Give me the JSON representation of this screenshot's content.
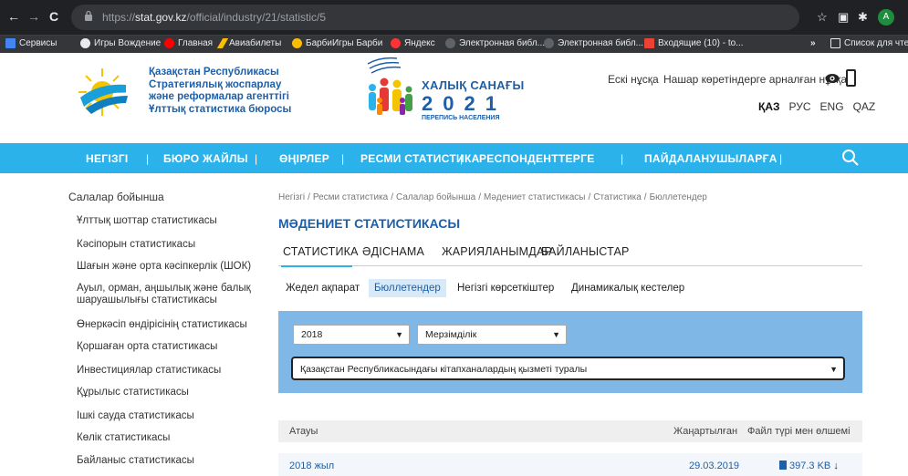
{
  "browser": {
    "back": "←",
    "forward": "→",
    "reload": "C",
    "url_prefix": "https://",
    "url_domain": "stat.gov.kz",
    "url_path": "/official/industry/21/statistic/5",
    "avatar": "A"
  },
  "bookmarks": [
    {
      "label": "Сервисы",
      "color": "#4285f4"
    },
    {
      "label": "Игры Вождение",
      "color": "#e8eaed"
    },
    {
      "label": "Главная",
      "color": "#ff0000"
    },
    {
      "label": "Авиабилеты",
      "color": "#fbbc04"
    },
    {
      "label": "БарбиИгры Барби",
      "color": "#fbbc04"
    },
    {
      "label": "Яндекс",
      "color": "#ff3333"
    },
    {
      "label": "Электронная библ...",
      "color": "#5f6368"
    },
    {
      "label": "Электронная библ...",
      "color": "#5f6368"
    },
    {
      "label": "Входящие (10) - to...",
      "color": "#ea4335"
    }
  ],
  "bookmarks_more": "»",
  "bookmarks_reading": "Список для чтения",
  "org": {
    "line1": "Қазақстан Республикасы",
    "line2": "Стратегиялық жоспарлау",
    "line3": "және реформалар агенттігі",
    "line4": "Ұлттық статистика бюросы"
  },
  "census": {
    "title": "ХАЛЫҚ САНАҒЫ",
    "year": "2021",
    "subtitle": "ПЕРЕПИСЬ НАСЕЛЕНИЯ"
  },
  "header_links": {
    "old_version": "Ескі нұсқа",
    "blind_version": "Нашар көретіндерге арналған нұсқа"
  },
  "languages": [
    {
      "label": "ҚАЗ",
      "active": true
    },
    {
      "label": "РУС",
      "active": false
    },
    {
      "label": "ENG",
      "active": false
    },
    {
      "label": "QAZ",
      "active": false
    }
  ],
  "nav": [
    "НЕГІЗГІ",
    "БЮРО ЖАЙЛЫ",
    "ӨҢІРЛЕР",
    "РЕСМИ СТАТИСТИКА",
    "РЕСПОНДЕНТТЕРГЕ",
    "ПАЙДАЛАНУШЫЛАРҒА"
  ],
  "sidebar": {
    "heading": "Салалар бойынша",
    "items": [
      "Ұлттық шоттар статистикасы",
      "Кәсіпорын статистикасы",
      "Шағын және орта кәсіпкерлік (ШОК)",
      "Ауыл, орман, аңшылық және балық шаруашылығы статистикасы",
      "Өнеркәсіп өндірісінің статистикасы",
      "Қоршаған орта статистикасы",
      "Инвестициялар статистикасы",
      "Құрылыс статистикасы",
      "Ішкі сауда статистикасы",
      "Көлік статистикасы",
      "Байланыс статистикасы"
    ]
  },
  "breadcrumb": [
    "Негізгі",
    "/",
    "Ресми статистика",
    "/",
    "Салалар бойынша",
    "/",
    "Мәдениет статистикасы",
    "/",
    "Статистика",
    "/",
    "Бюллетендер"
  ],
  "page_title": "МӘДЕНИЕТ СТАТИСТИКАСЫ",
  "tabs": [
    "СТАТИСТИКА",
    "ӘДІСНАМА",
    "ЖАРИЯЛАНЫМДАР",
    "БАЙЛАНЫСТАР"
  ],
  "subtabs": [
    {
      "label": "Жедел ақпарат",
      "active": false
    },
    {
      "label": "Бюллетендер",
      "active": true
    },
    {
      "label": "Негізгі көрсеткіштер",
      "active": false
    },
    {
      "label": "Динамикалық кестелер",
      "active": false
    }
  ],
  "filters": {
    "year": "2018",
    "period": "Мерзімділік",
    "publication": "Қазақстан Республикасындағы кітапханалардың қызметі туралы"
  },
  "table": {
    "headers": {
      "name": "Атауы",
      "updated": "Жаңартылған",
      "filetype": "Файл түрі мен өлшемі"
    },
    "rows": [
      {
        "name": "2018 жыл",
        "updated": "29.03.2019",
        "size": "397.3 KB"
      }
    ]
  },
  "colors": {
    "brand": "#1d5fa8",
    "nav": "#2cb2ea",
    "filter_panel": "#7fb7e6"
  }
}
